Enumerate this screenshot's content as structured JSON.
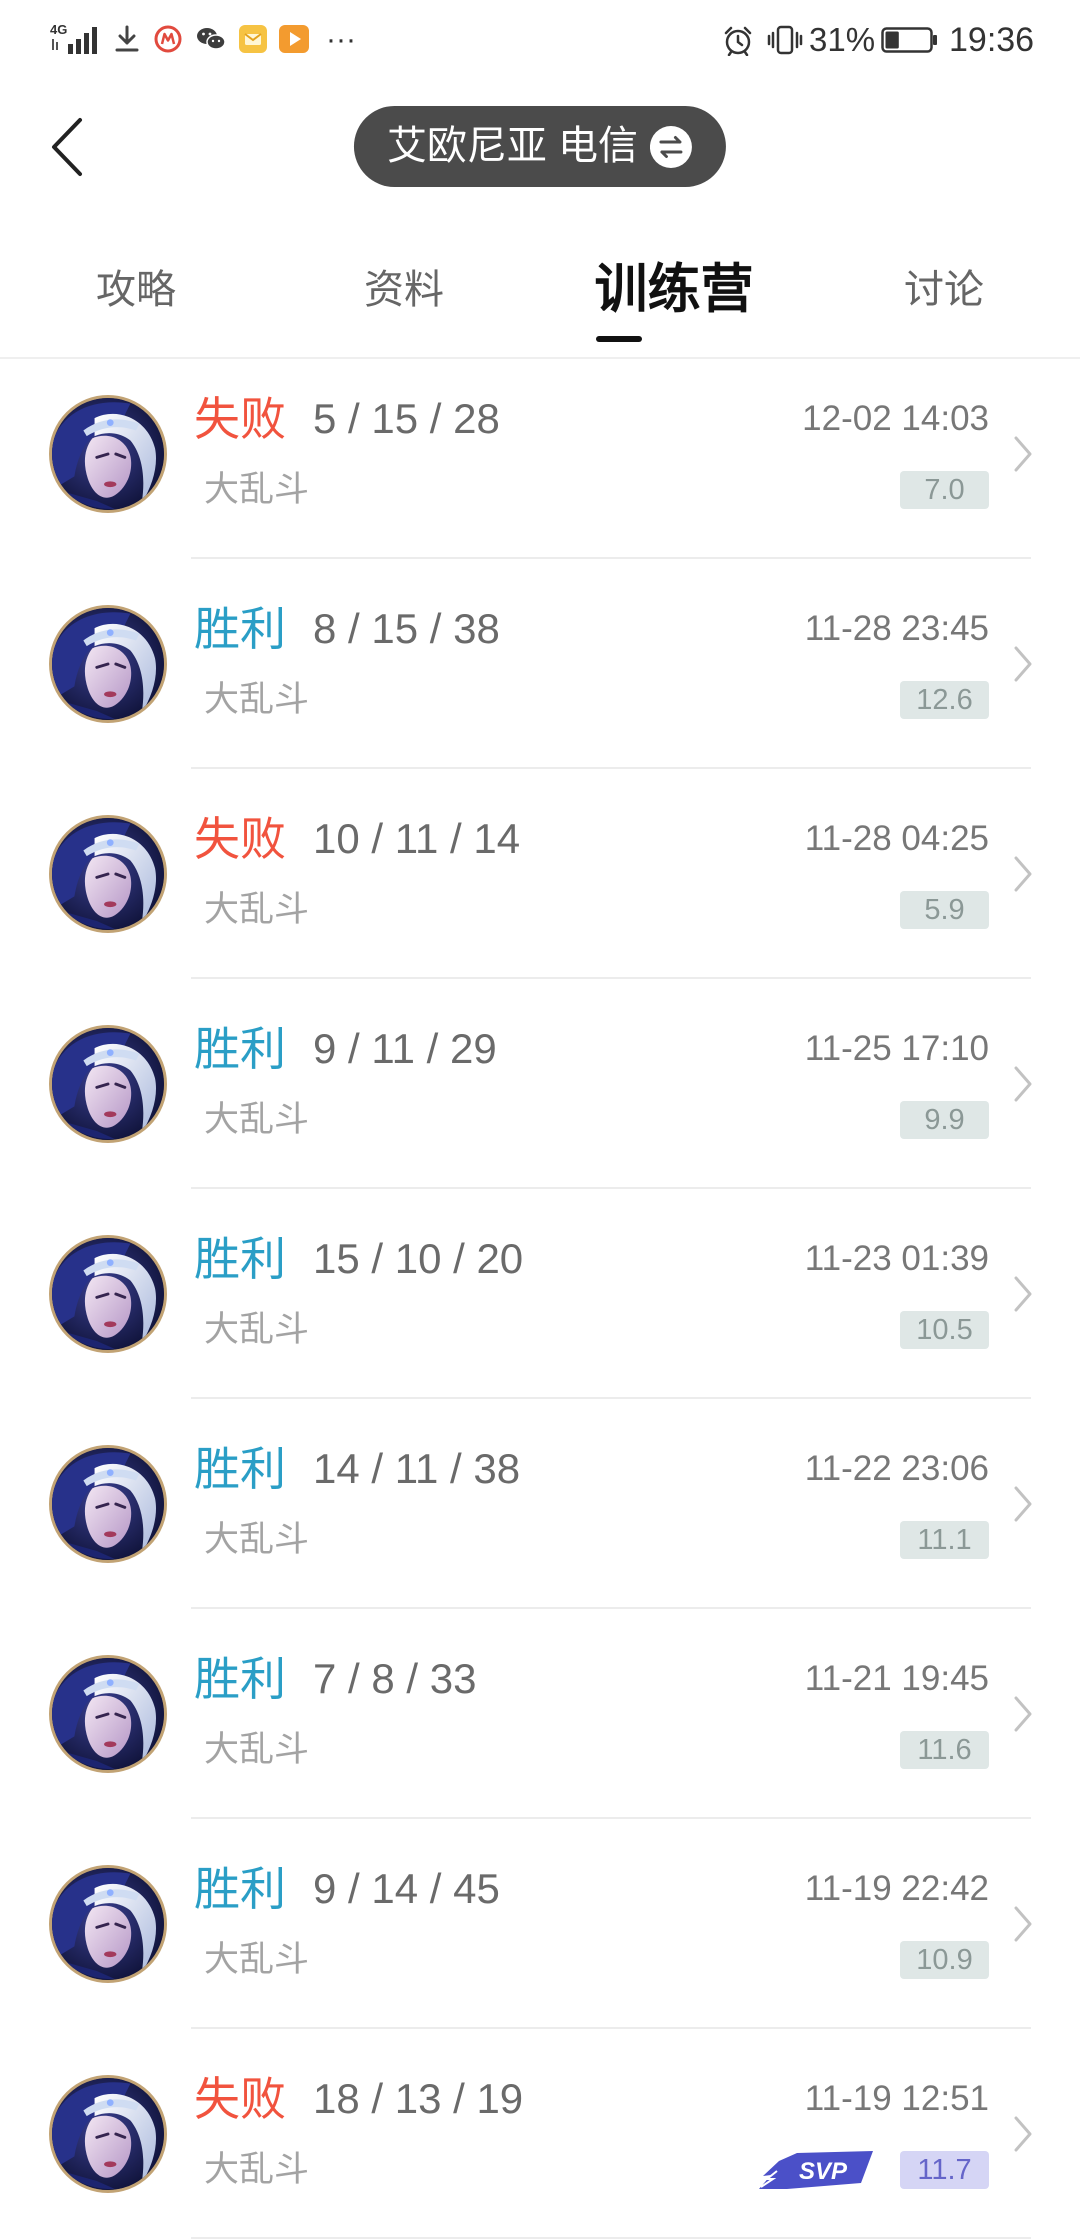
{
  "status_bar": {
    "network": "4G",
    "more": "···",
    "battery": "31%",
    "time": "19:36",
    "icons": [
      "signal-icon",
      "download-icon",
      "app-notification-icon",
      "wechat-icon",
      "message-app-icon",
      "video-app-icon",
      "alarm-icon",
      "vibrate-icon",
      "battery-icon"
    ]
  },
  "header": {
    "back_icon": "chevron-left-icon",
    "server": "艾欧尼亚 电信",
    "switch_icon": "swap-icon"
  },
  "tabs": [
    "攻略",
    "资料",
    "训练营",
    "讨论"
  ],
  "active_tab": "训练营",
  "colors": {
    "result": {
      "胜利": "#2a9ec6",
      "失败": "#f1533e"
    },
    "score_bg": "#dfe7e6",
    "score_text": "#8b9896",
    "svp_score_bg": "#d5d5f5",
    "svp_score_text": "#6565c9",
    "svp_logo": "#4b50c8"
  },
  "rows": [
    {
      "result": "失败",
      "kda": "5 / 15 / 28",
      "mode": "大乱斗",
      "time": "12-02 14:03",
      "score": "7.0"
    },
    {
      "result": "胜利",
      "kda": "8 / 15 / 38",
      "mode": "大乱斗",
      "time": "11-28 23:45",
      "score": "12.6"
    },
    {
      "result": "失败",
      "kda": "10 / 11 / 14",
      "mode": "大乱斗",
      "time": "11-28 04:25",
      "score": "5.9"
    },
    {
      "result": "胜利",
      "kda": "9 / 11 / 29",
      "mode": "大乱斗",
      "time": "11-25 17:10",
      "score": "9.9"
    },
    {
      "result": "胜利",
      "kda": "15 / 10 / 20",
      "mode": "大乱斗",
      "time": "11-23 01:39",
      "score": "10.5"
    },
    {
      "result": "胜利",
      "kda": "14 / 11 / 38",
      "mode": "大乱斗",
      "time": "11-22 23:06",
      "score": "11.1"
    },
    {
      "result": "胜利",
      "kda": "7 / 8 / 33",
      "mode": "大乱斗",
      "time": "11-21 19:45",
      "score": "11.6"
    },
    {
      "result": "胜利",
      "kda": "9 / 14 / 45",
      "mode": "大乱斗",
      "time": "11-19 22:42",
      "score": "10.9"
    },
    {
      "result": "失败",
      "kda": "18 / 13 / 19",
      "mode": "大乱斗",
      "time": "11-19 12:51",
      "score": "11.7",
      "badge": "SVP"
    }
  ]
}
